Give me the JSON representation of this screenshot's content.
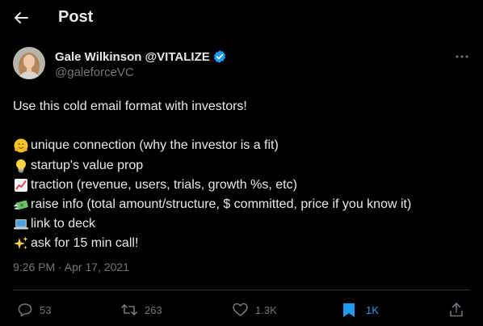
{
  "header": {
    "title": "Post"
  },
  "author": {
    "name": "Gale Wilkinson @VITALIZE",
    "handle": "@galeforceVC"
  },
  "tweet": {
    "intro": "Use this cold email format with investors!",
    "items": [
      {
        "icon": "hugging-face-emoji-icon",
        "text": "unique connection (why the investor is a fit)"
      },
      {
        "icon": "light-bulb-emoji-icon",
        "text": " startup's value prop"
      },
      {
        "icon": "chart-increasing-emoji-icon",
        "text": "traction (revenue, users, trials, growth %s, etc)"
      },
      {
        "icon": "money-with-wings-emoji-icon",
        "text": "raise info (total amount/structure, $ committed, price if you know it)"
      },
      {
        "icon": "laptop-emoji-icon",
        "text": "link to deck"
      },
      {
        "icon": "sparkles-emoji-icon",
        "text": " ask for 15 min call!"
      }
    ]
  },
  "meta": {
    "timestamp": "9:26 PM · Apr 17, 2021"
  },
  "actions": {
    "replies": "53",
    "reposts": "263",
    "likes": "1.3K",
    "bookmarks": "1K"
  },
  "colors": {
    "background": "#000000",
    "text": "#e7e9ea",
    "secondary": "#71767b",
    "accent": "#1d9bf0",
    "divider": "#2f3336"
  }
}
